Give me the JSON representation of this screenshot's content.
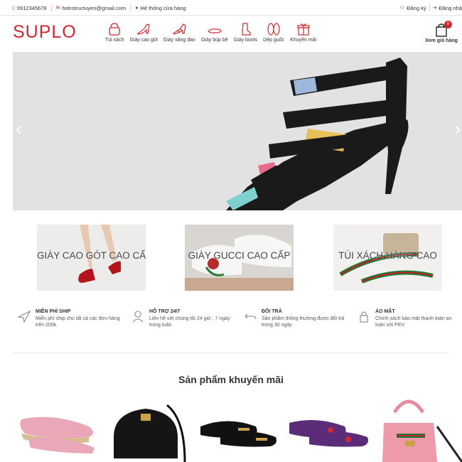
{
  "topbar": {
    "phone": "0912345678",
    "email": "hotrotructuyen@gmail.com",
    "stores": "Hệ thống cửa hàng",
    "register": "Đăng ký",
    "login": "Đăng nhậ"
  },
  "header": {
    "logo": "SUPLO",
    "categories": [
      {
        "label": "Túi xách",
        "icon": "handbag-icon"
      },
      {
        "label": "Giày cao gót",
        "icon": "high-heel-icon"
      },
      {
        "label": "Giày xăng đan",
        "icon": "sandal-icon"
      },
      {
        "label": "Giày búp bê",
        "icon": "flat-shoe-icon"
      },
      {
        "label": "Giày boots",
        "icon": "boot-icon"
      },
      {
        "label": "Dép guốc",
        "icon": "slipper-icon"
      },
      {
        "label": "Khuyến mãi",
        "icon": "gift-icon"
      }
    ],
    "cart": {
      "count": "0",
      "label": "Xem giỏ hàng"
    }
  },
  "banner": {
    "prev": "‹",
    "next": "›"
  },
  "promos": [
    {
      "caption": "GIÀY CAO GÓT CAO CẤP"
    },
    {
      "caption": "GIÀY GUCCI CAO CẤP"
    },
    {
      "caption": "TÚI XÁCH HÀNG CAO"
    }
  ],
  "features": [
    {
      "title": "MIỄN PHÍ SHIP",
      "desc": "Miễn phí ship cho tất cả các đơn hàng trên 200k",
      "icon": "plane-icon"
    },
    {
      "title": "HỖ TRỢ 24/7",
      "desc": "Liên hệ với chúng tôi 24 giờ , 7 ngày trong tuần",
      "icon": "support-icon"
    },
    {
      "title": "ĐỔI TRẢ",
      "desc": "Sản phẩm thông thường được đổi trả trong 30 ngày",
      "icon": "return-icon"
    },
    {
      "title": "ÁO MẬT",
      "desc": "Chính sách bảo mật thanh toán an toàn với PEV",
      "icon": "lock-icon"
    }
  ],
  "products_section": {
    "title": "Sản phẩm khuyến mãi"
  },
  "colors": {
    "brand": "#d0282e"
  }
}
